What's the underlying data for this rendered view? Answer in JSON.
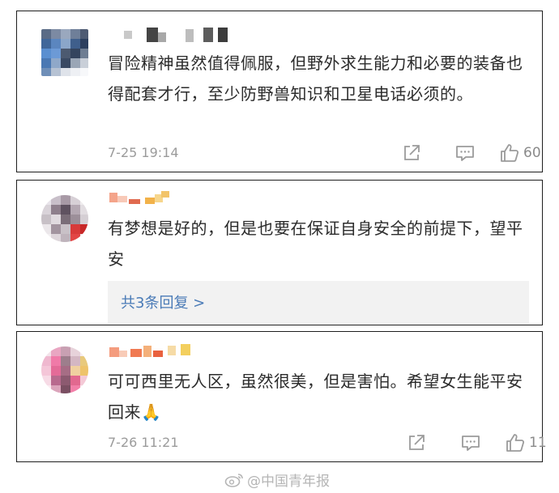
{
  "comments": [
    {
      "text": "冒险精神虽然值得佩服，但野外求生能力和必要的装备也得配套才行，至少防野兽知识和卫星电话必须的。",
      "timestamp": "7-25 19:14",
      "like_count": "60",
      "username_masked": true,
      "avatar_masked": true
    },
    {
      "text": "有梦想是好的，但是也要在保证自身安全的前提下，望平安",
      "reply_label": "共3条回复 >",
      "username_masked": true,
      "avatar_masked": true
    },
    {
      "text": "可可西里无人区，虽然很美，但是害怕。希望女生能平安回来🙏",
      "timestamp": "7-26 11:21",
      "like_count": "11",
      "username_masked": true,
      "avatar_masked": true
    }
  ],
  "icons": {
    "share": "share-icon",
    "comment": "comment-icon",
    "like": "thumbs-up-icon",
    "brand": "weibo-icon"
  },
  "colors": {
    "text": "#2b2b2b",
    "meta": "#9b9b9b",
    "reply_link": "#4a7bb7",
    "reply_bg": "#f2f2f2",
    "card_border": "#1f1f1f"
  },
  "watermark": "@中国青年报"
}
